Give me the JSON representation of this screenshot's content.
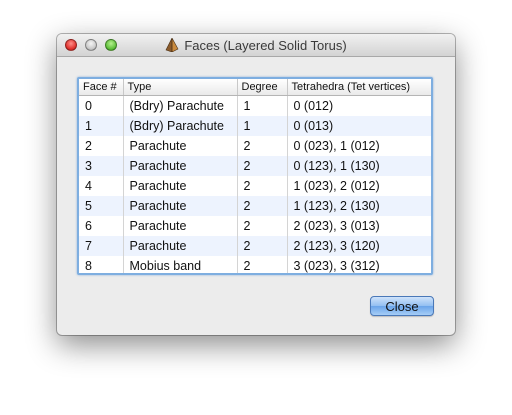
{
  "window": {
    "title": "Faces (Layered Solid Torus)",
    "title_icon": "regina-pyramid-icon"
  },
  "table": {
    "columns": [
      "Face #",
      "Type",
      "Degree",
      "Tetrahedra (Tet vertices)"
    ],
    "rows": [
      [
        "0",
        "(Bdry) Parachute",
        "1",
        "0 (012)"
      ],
      [
        "1",
        "(Bdry) Parachute",
        "1",
        "0 (013)"
      ],
      [
        "2",
        "Parachute",
        "2",
        "0 (023), 1 (012)"
      ],
      [
        "3",
        "Parachute",
        "2",
        "0 (123), 1 (130)"
      ],
      [
        "4",
        "Parachute",
        "2",
        "1 (023), 2 (012)"
      ],
      [
        "5",
        "Parachute",
        "2",
        "1 (123), 2 (130)"
      ],
      [
        "6",
        "Parachute",
        "2",
        "2 (023), 3 (013)"
      ],
      [
        "7",
        "Parachute",
        "2",
        "2 (123), 3 (120)"
      ],
      [
        "8",
        "Mobius band",
        "2",
        "3 (023), 3 (312)"
      ]
    ]
  },
  "buttons": {
    "close_label": "Close"
  },
  "colors": {
    "row_stripe": "#edf3fe",
    "focus_border": "#7eaee0",
    "default_button": "#93bff2"
  }
}
